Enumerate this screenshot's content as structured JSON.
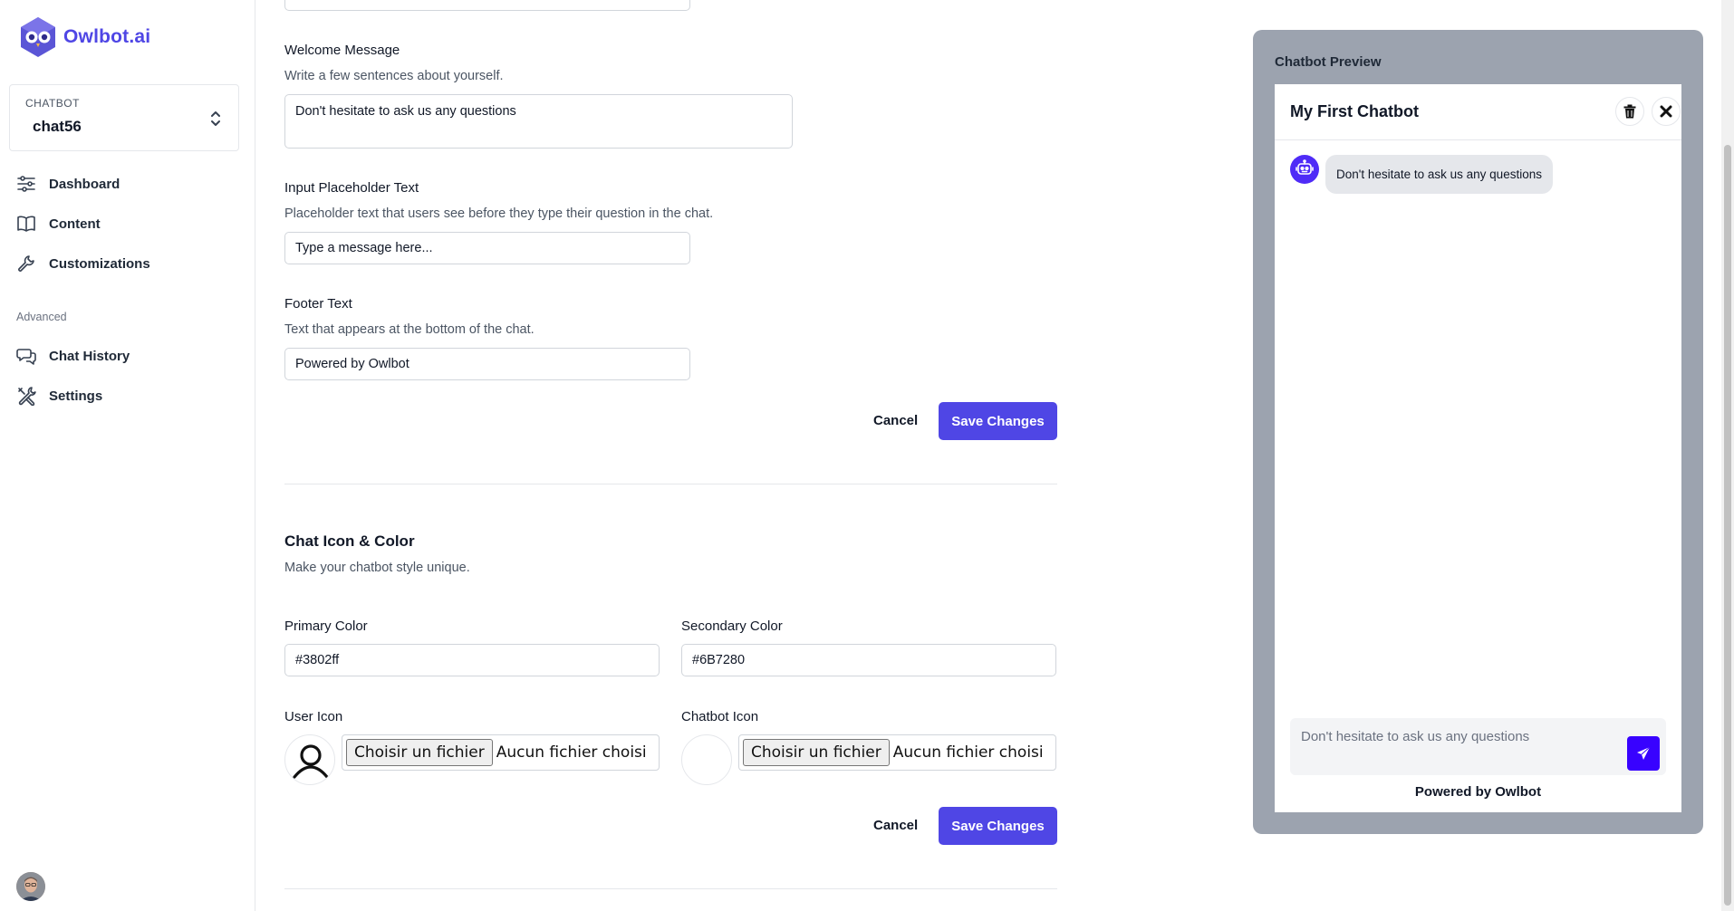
{
  "brand": {
    "name": "Owlbot.ai",
    "accent": "#4f46e5"
  },
  "chatbot_selector": {
    "caption": "CHATBOT",
    "value": "chat56"
  },
  "nav": {
    "primary": [
      {
        "label": "Dashboard",
        "icon": "sliders-icon"
      },
      {
        "label": "Content",
        "icon": "book-icon"
      },
      {
        "label": "Customizations",
        "icon": "wrench-icon"
      }
    ],
    "group_label": "Advanced",
    "advanced": [
      {
        "label": "Chat History",
        "icon": "chat-bubbles-icon"
      },
      {
        "label": "Settings",
        "icon": "tools-icon"
      }
    ]
  },
  "form": {
    "welcome": {
      "label": "Welcome Message",
      "help": "Write a few sentences about yourself.",
      "value": "Don't hesitate to ask us any questions"
    },
    "placeholder": {
      "label": "Input Placeholder Text",
      "help": "Placeholder text that users see before they type their question in the chat.",
      "value": "Type a message here..."
    },
    "footer": {
      "label": "Footer Text",
      "help": "Text that appears at the bottom of the chat.",
      "value": "Powered by Owlbot"
    },
    "cancel_label": "Cancel",
    "save_label": "Save Changes"
  },
  "appearance": {
    "title": "Chat Icon & Color",
    "subtitle": "Make your chatbot style unique.",
    "primary_color": {
      "label": "Primary Color",
      "value": "#3802ff"
    },
    "secondary_color": {
      "label": "Secondary Color",
      "value": "#6B7280"
    },
    "user_icon": {
      "label": "User Icon",
      "button": "Choisir un fichier",
      "status": "Aucun fichier choisi"
    },
    "chatbot_icon": {
      "label": "Chatbot Icon",
      "button": "Choisir un fichier",
      "status": "Aucun fichier choisi"
    },
    "cancel_label": "Cancel",
    "save_label": "Save Changes"
  },
  "preview": {
    "title": "Chatbot Preview",
    "chat_name": "My First Chatbot",
    "bot_message": "Don't hesitate to ask us any questions",
    "input_text": "Don't hesitate to ask us any questions",
    "footer": "Powered by Owlbot",
    "send_color": "#3802ff"
  }
}
